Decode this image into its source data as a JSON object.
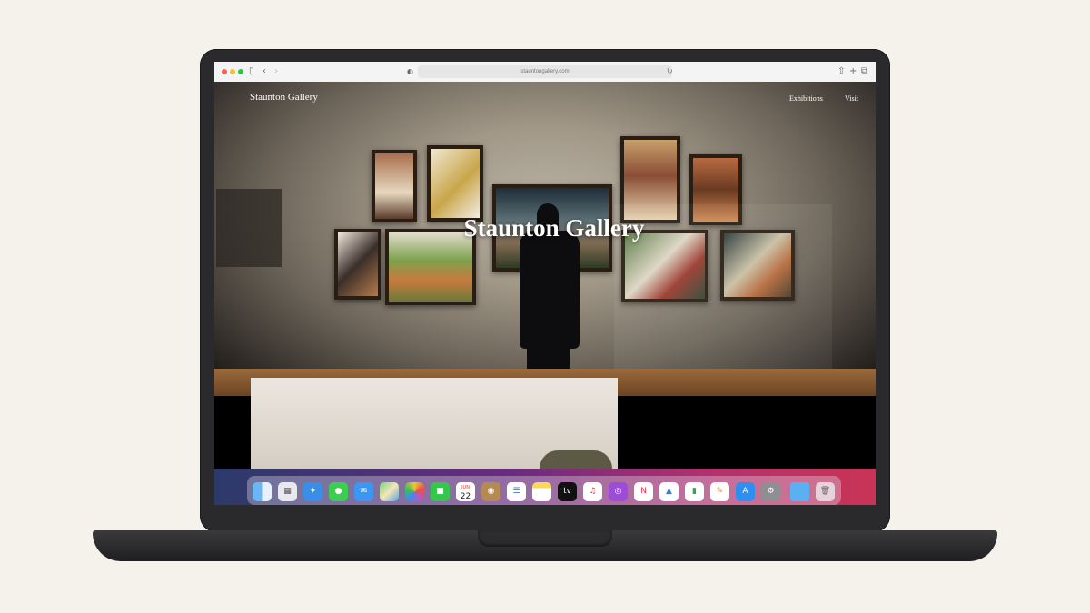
{
  "browser": {
    "url": "stauntongallery.com",
    "traffic_colors": [
      "#ff5f57",
      "#febc2e",
      "#28c840"
    ],
    "icons": [
      "sidebar-icon",
      "back-icon",
      "forward-icon",
      "shield-icon",
      "reload-icon",
      "share-icon",
      "new-tab-icon",
      "tabs-icon"
    ]
  },
  "site": {
    "brand": "Staunton Gallery",
    "nav": [
      "Exhibitions",
      "Visit"
    ],
    "hero_title": "Staunton Gallery"
  },
  "dock": {
    "calendar_month": "JUN",
    "calendar_day": "22",
    "apps": [
      "finder",
      "launchpad",
      "safari",
      "messages",
      "mail",
      "maps",
      "photos",
      "facetime",
      "calendar",
      "contacts",
      "reminders",
      "notes",
      "tv",
      "music",
      "podcasts",
      "news",
      "keynote",
      "numbers",
      "pages",
      "app-store",
      "system-preferences",
      "downloads",
      "trash"
    ]
  }
}
